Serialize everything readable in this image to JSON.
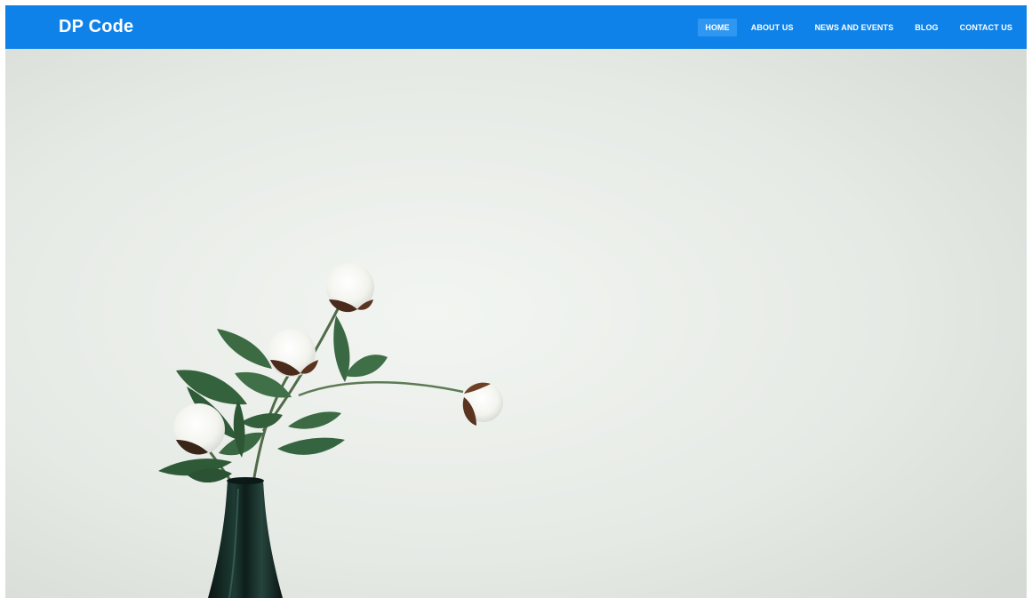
{
  "colors": {
    "navbar": "#0e82e8",
    "active_item": "#2f97f2",
    "wall_light": "#f1f4f0",
    "wall_dark": "#d9ddd8",
    "leaf": "#3d6b44",
    "leaf_dark": "#2d5434",
    "vase": "#0f1f1c",
    "petal": "#fbfbf7",
    "bract": "#4a2a1a"
  },
  "brand": {
    "name": "DP Code"
  },
  "nav": {
    "active_index": 0,
    "items": [
      {
        "label": "HOME"
      },
      {
        "label": "ABOUT US"
      },
      {
        "label": "NEWS AND EVENTS"
      },
      {
        "label": "BLOG"
      },
      {
        "label": "CONTACT US"
      }
    ]
  },
  "hero": {
    "image_subject": "cotton-stems-in-dark-vase"
  }
}
